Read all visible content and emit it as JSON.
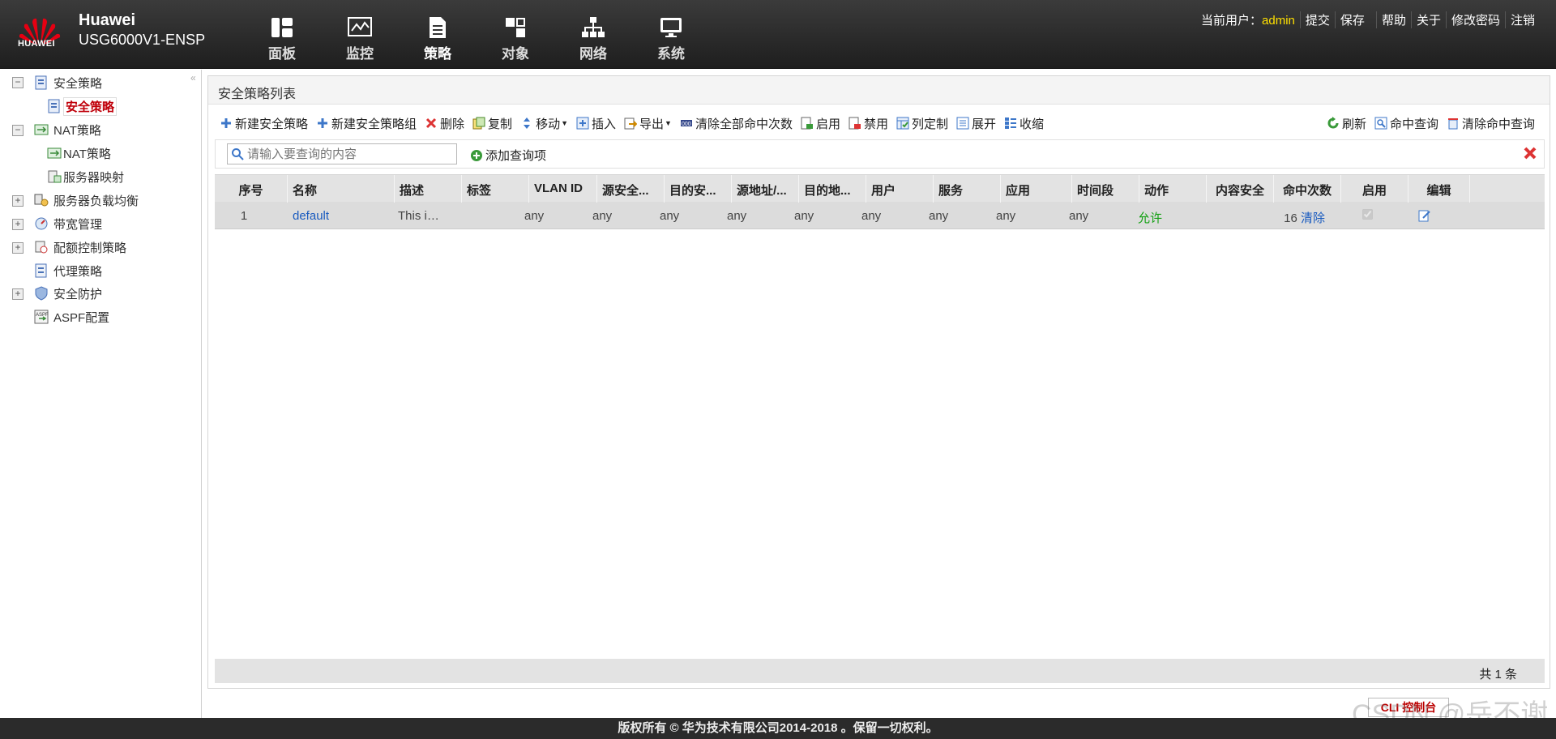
{
  "header": {
    "logo_text": "HUAWEI",
    "brand_name": "Huawei",
    "device_model": "USG6000V1-ENSP",
    "nav": [
      {
        "label": "面板",
        "icon": "dashboard-icon"
      },
      {
        "label": "监控",
        "icon": "monitor-icon"
      },
      {
        "label": "策略",
        "icon": "policy-icon",
        "active": true
      },
      {
        "label": "对象",
        "icon": "object-icon"
      },
      {
        "label": "网络",
        "icon": "network-icon"
      },
      {
        "label": "系统",
        "icon": "system-icon"
      }
    ],
    "current_user_label": "当前用户：",
    "current_user": "admin",
    "links": [
      "提交",
      "保存",
      "帮助",
      "关于",
      "修改密码",
      "注销"
    ]
  },
  "sidebar": {
    "items": [
      {
        "label": "安全策略",
        "expanded": true
      },
      {
        "label": "安全策略",
        "active": true
      },
      {
        "label": "NAT策略",
        "expanded": true
      },
      {
        "label": "NAT策略"
      },
      {
        "label": "服务器映射"
      },
      {
        "label": "服务器负载均衡"
      },
      {
        "label": "带宽管理"
      },
      {
        "label": "配额控制策略"
      },
      {
        "label": "代理策略"
      },
      {
        "label": "安全防护"
      },
      {
        "label": "ASPF配置"
      }
    ]
  },
  "main": {
    "title": "安全策略列表",
    "toolbar": [
      "新建安全策略",
      "新建安全策略组",
      "删除",
      "复制",
      "移动",
      "插入",
      "导出",
      "清除全部命中次数",
      "启用",
      "禁用",
      "列定制",
      "展开",
      "收缩"
    ],
    "toolbar_right": [
      "刷新",
      "命中查询",
      "清除命中查询"
    ],
    "search_placeholder": "请输入要查询的内容",
    "add_query": "添加查询项",
    "columns": [
      "序号",
      "名称",
      "描述",
      "标签",
      "VLAN ID",
      "源安全...",
      "目的安...",
      "源地址/...",
      "目的地...",
      "用户",
      "服务",
      "应用",
      "时间段",
      "动作",
      "内容安全",
      "命中次数",
      "启用",
      "编辑"
    ],
    "rows": [
      {
        "seq": "1",
        "name": "default",
        "desc": "This is t...",
        "tag": "",
        "vlan": "any",
        "src_zone": "any",
        "dst_zone": "any",
        "src_addr": "any",
        "dst_addr": "any",
        "user": "any",
        "service": "any",
        "app": "any",
        "time": "any",
        "action": "允许",
        "content_security": "",
        "hits": "16",
        "clear": "清除"
      }
    ],
    "total": "共 1 条"
  },
  "cli_button": "CLI 控制台",
  "watermark": "CSDN @岳不谢",
  "footer": "版权所有 © 华为技术有限公司2014-2018 。保留一切权利。",
  "colors": {
    "accent_red": "#c0000a",
    "link_blue": "#1a5bbf",
    "allow_green": "#12a012",
    "user_yellow": "#ffe000"
  }
}
